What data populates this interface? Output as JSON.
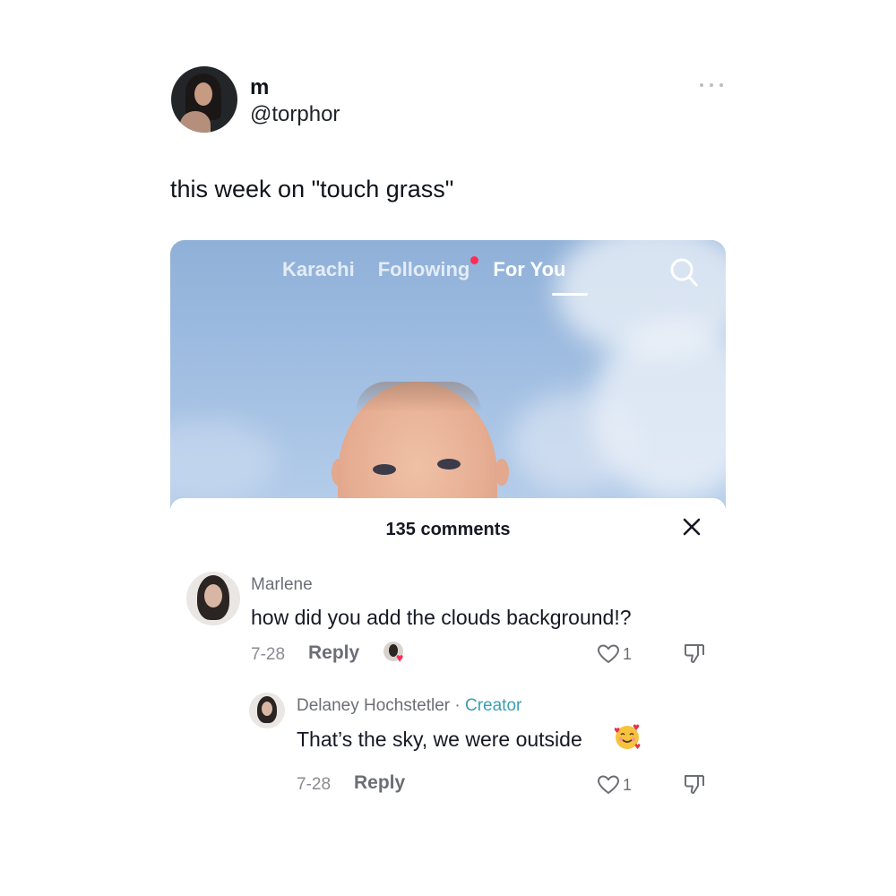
{
  "tweet": {
    "display_name": "m",
    "handle": "@torphor",
    "text": "this week on \"touch grass\"",
    "more_icon": "more-horizontal-icon"
  },
  "tiktok": {
    "tabs": [
      {
        "label": "Karachi",
        "active": false
      },
      {
        "label": "Following",
        "active": false,
        "notification_dot": true
      },
      {
        "label": "For You",
        "active": true
      }
    ],
    "search_icon": "search-icon",
    "comments_title": "135 comments",
    "close_icon": "close-icon",
    "comments": [
      {
        "author": "Marlene",
        "text": "how did you add the clouds background!?",
        "date": "7-28",
        "reply_label": "Reply",
        "likes": "1",
        "liked_by_creator": true
      },
      {
        "author": "Delaney Hochstetler",
        "separator": " · ",
        "badge": "Creator",
        "text": "That’s the sky, we were outside",
        "emoji": "smiling-face-with-hearts",
        "date": "7-28",
        "reply_label": "Reply",
        "likes": "1"
      }
    ]
  },
  "colors": {
    "accent_red": "#fe2c55",
    "creator_teal": "#3a9fb2",
    "sky_blue": "#a3c0e3"
  }
}
